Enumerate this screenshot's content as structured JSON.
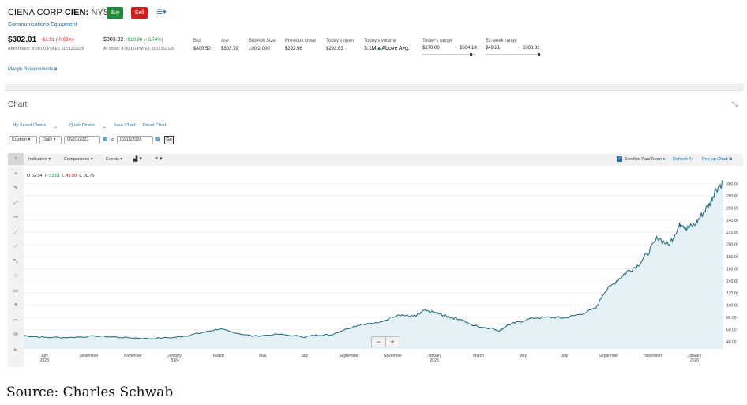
{
  "header": {
    "company": "CIENA CORP",
    "symbol": "CIEN:",
    "exchange": "NYSE",
    "buy_label": "Buy",
    "sell_label": "Sell",
    "menu_icon": "list-menu-icon",
    "industry": "Communications Equipment"
  },
  "quote": {
    "last_price": "$302.01",
    "after_hours_change": "-$1.91",
    "after_hours_pct": "(-0.63%)",
    "after_hours_note": "After hours: 8:00:00 PM ET, 02/13/2026",
    "close_price": "$303.92",
    "close_change": "+$10.96",
    "close_pct": "(+3.74%)",
    "close_note": "At close: 4:00:00 PM ET, 02/13/2026",
    "bid_label": "Bid",
    "bid": "$300.50",
    "ask_label": "Ask",
    "ask": "$303.79",
    "bidask_size_label": "Bid/Ask Size",
    "bidask_size": "100/2,000",
    "prev_close_label": "Previous close",
    "prev_close": "$292.96",
    "open_label": "Today's open",
    "open": "$293.83",
    "volume_label": "Today's volume",
    "volume": "3.1M",
    "volume_note": "Above Avg.",
    "day_range_label": "Today's range",
    "day_low": "$270.00",
    "day_high": "$304.18",
    "day_range_position": 0.93,
    "week52_label": "52-week range",
    "week52_low": "$49.21",
    "week52_high": "$308.81",
    "week52_position": 0.98
  },
  "margin_link": "Margin Requirements",
  "chart_section": {
    "heading": "Chart",
    "my_saved": "My Saved Charts",
    "quick": "Quick Charts",
    "save": "Save Chart",
    "reset": "Reset Chart",
    "range_select": "Custom",
    "period_select": "Daily",
    "from_date": "06/01/2023",
    "to_label": "to",
    "to_date": "02/15/2026",
    "go_label": "Go",
    "indicators": "Indicators",
    "comparisons": "Comparisons",
    "events": "Events",
    "scroll_label": "Scroll to Pan/Zoom",
    "refresh": "Refresh",
    "popup": "Pop-up Chart",
    "ohlc": {
      "o_label": "O",
      "o": "52.54",
      "h_label": "H",
      "h": "53.61",
      "l_label": "L",
      "l": "49.88",
      "c_label": "C",
      "c": "50.75"
    },
    "zoom_out": "−",
    "zoom_in": "+"
  },
  "chart_data": {
    "type": "area",
    "series": [
      {
        "values": [
          [
            2023.42,
            50
          ],
          [
            2023.5,
            47
          ],
          [
            2023.6,
            47
          ],
          [
            2023.7,
            49
          ],
          [
            2023.8,
            47
          ],
          [
            2023.9,
            45
          ],
          [
            2024.0,
            47
          ],
          [
            2024.05,
            50
          ],
          [
            2024.12,
            56
          ],
          [
            2024.17,
            61
          ],
          [
            2024.22,
            56
          ],
          [
            2024.3,
            49
          ],
          [
            2024.4,
            52
          ],
          [
            2024.5,
            48
          ],
          [
            2024.55,
            51
          ],
          [
            2024.6,
            51
          ],
          [
            2024.66,
            61
          ],
          [
            2024.72,
            69
          ],
          [
            2024.78,
            70
          ],
          [
            2024.86,
            85
          ],
          [
            2024.9,
            82
          ],
          [
            2024.93,
            82
          ],
          [
            2024.96,
            91
          ],
          [
            2025.0,
            88
          ],
          [
            2025.03,
            84
          ],
          [
            2025.06,
            80
          ],
          [
            2025.1,
            77
          ],
          [
            2025.14,
            68
          ],
          [
            2025.18,
            64
          ],
          [
            2025.22,
            62
          ],
          [
            2025.25,
            58
          ],
          [
            2025.28,
            67
          ],
          [
            2025.32,
            72
          ],
          [
            2025.38,
            79
          ],
          [
            2025.45,
            80
          ],
          [
            2025.5,
            79
          ],
          [
            2025.55,
            84
          ],
          [
            2025.62,
            94
          ],
          [
            2025.65,
            120
          ],
          [
            2025.7,
            140
          ],
          [
            2025.74,
            155
          ],
          [
            2025.78,
            165
          ],
          [
            2025.82,
            185
          ],
          [
            2025.86,
            212
          ],
          [
            2025.9,
            198
          ],
          [
            2025.93,
            222
          ],
          [
            2025.95,
            236
          ],
          [
            2025.97,
            226
          ],
          [
            2026.0,
            232
          ],
          [
            2026.03,
            250
          ],
          [
            2026.06,
            268
          ],
          [
            2026.08,
            290
          ],
          [
            2026.11,
            302
          ]
        ]
      }
    ],
    "x_ticks": [
      {
        "x": 2023.5,
        "label": "July",
        "sub": "2023"
      },
      {
        "x": 2023.67,
        "label": "September",
        "sub": ""
      },
      {
        "x": 2023.84,
        "label": "November",
        "sub": ""
      },
      {
        "x": 2024.0,
        "label": "January",
        "sub": "2024"
      },
      {
        "x": 2024.17,
        "label": "March",
        "sub": ""
      },
      {
        "x": 2024.34,
        "label": "May",
        "sub": ""
      },
      {
        "x": 2024.5,
        "label": "July",
        "sub": ""
      },
      {
        "x": 2024.67,
        "label": "September",
        "sub": ""
      },
      {
        "x": 2024.84,
        "label": "November",
        "sub": ""
      },
      {
        "x": 2025.0,
        "label": "January",
        "sub": "2025"
      },
      {
        "x": 2025.17,
        "label": "March",
        "sub": ""
      },
      {
        "x": 2025.34,
        "label": "May",
        "sub": ""
      },
      {
        "x": 2025.5,
        "label": "July",
        "sub": ""
      },
      {
        "x": 2025.67,
        "label": "September",
        "sub": ""
      },
      {
        "x": 2025.84,
        "label": "November",
        "sub": ""
      },
      {
        "x": 2026.0,
        "label": "January",
        "sub": "2026"
      }
    ],
    "y_ticks": [
      "40.00",
      "60.00",
      "80.00",
      "100.00",
      "120.00",
      "140.00",
      "160.00",
      "180.00",
      "200.00",
      "220.00",
      "240.00",
      "260.00",
      "280.00",
      "300.00"
    ],
    "ylim": [
      28,
      306
    ],
    "xlim": [
      2023.42,
      2026.12
    ],
    "grid": true,
    "colors": {
      "line": "#2b6e82",
      "fill": "#e4f2f8",
      "grid": "#e8e8e8"
    }
  },
  "left_tools": [
    "cursor-icon",
    "crosshair-icon",
    "annotation-icon",
    "line-tool-icon",
    "horizontal-ray-icon",
    "ray-icon",
    "fibonacci-icon",
    "segment-icon",
    "circle-icon",
    "rectangle-icon",
    "channel-icon",
    "arc-icon",
    "measure-icon",
    "projection-icon"
  ],
  "source_note": "Source:  Charles Schwab"
}
